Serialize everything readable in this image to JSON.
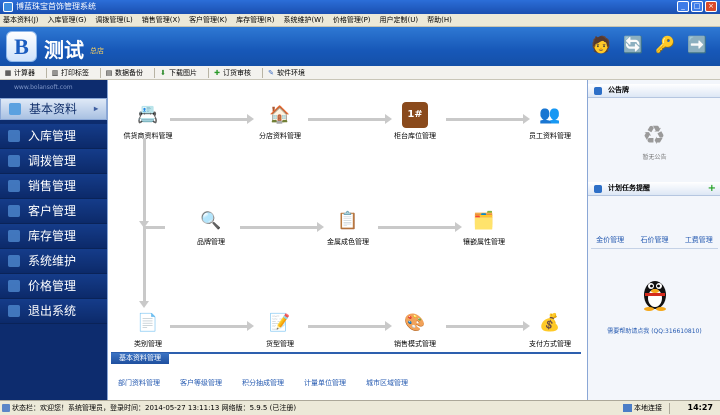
{
  "window": {
    "title": "博蓝珠宝首饰管理系统",
    "buttons": [
      "_",
      "□",
      "×"
    ]
  },
  "menu": [
    "基本资料(J)",
    "入库管理(G)",
    "调拨管理(L)",
    "销售管理(X)",
    "客户管理(K)",
    "库存管理(R)",
    "系统维护(W)",
    "价格管理(P)",
    "用户定制(U)",
    "帮助(H)"
  ],
  "header": {
    "logo_letter": "B",
    "brand": "测试",
    "store": "总店"
  },
  "toolbar": [
    "计算器",
    "打印标签",
    "数据备份",
    "下载图片",
    "订货审核",
    "软件环境"
  ],
  "sidebar": {
    "url": "www.bolansoft.com",
    "active": "基本资料",
    "items": [
      "入库管理",
      "调拨管理",
      "销售管理",
      "客户管理",
      "库存管理",
      "系统维护",
      "价格管理",
      "退出系统"
    ]
  },
  "flow": {
    "row1": [
      "供货商资料管理",
      "分店资料管理",
      "柜台库位管理",
      "员工资料管理"
    ],
    "row2": [
      "品牌管理",
      "金属成色管理",
      "镶嵌属性管理"
    ],
    "row3": [
      "类别管理",
      "货型管理",
      "销售模式管理",
      "支付方式管理"
    ]
  },
  "section": {
    "title": "基本资料管理",
    "links": [
      "部门资料管理",
      "客户等级管理",
      "积分抽成管理",
      "计量单位管理",
      "城市区域管理"
    ]
  },
  "right": {
    "notice_title": "公告牌",
    "no_notice": "暂无公告",
    "plan_title": "计划任务提醒",
    "plan_add": "+",
    "tabs": [
      "金价管理",
      "石价管理",
      "工费管理"
    ],
    "help_text": "需要帮助请点我 (QQ:316610810)"
  },
  "status": {
    "text": "状态栏：欢迎您！系统管理员，登录时间：2014-05-27 13:11:13 网络版：5.9.5 (已注册)",
    "connection": "本地连接",
    "time": "14:27"
  }
}
